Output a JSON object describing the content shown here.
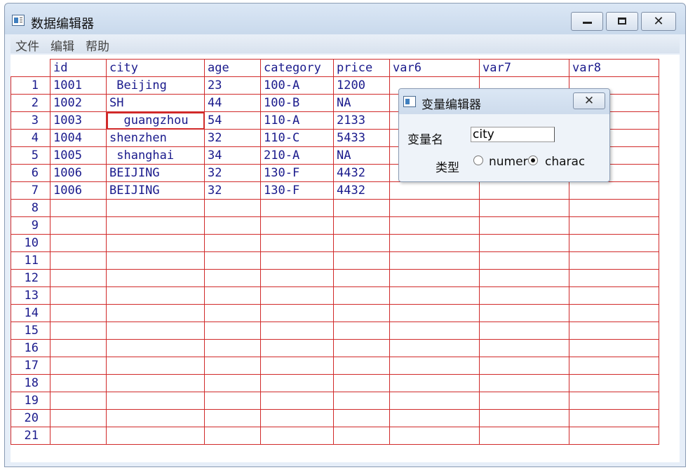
{
  "window": {
    "title": "数据编辑器"
  },
  "menu": [
    "文件",
    "编辑",
    "帮助"
  ],
  "grid": {
    "columns": [
      "id",
      "city",
      "age",
      "category",
      "price",
      "var6",
      "var7",
      "var8"
    ],
    "rows": [
      [
        "1001",
        " Beijing",
        "23",
        "100-A",
        "1200",
        "",
        "",
        ""
      ],
      [
        "1002",
        "SH",
        "44",
        "100-B",
        "NA",
        "",
        "",
        ""
      ],
      [
        "1003",
        "  guangzhou",
        "54",
        "110-A",
        "2133",
        "",
        "",
        ""
      ],
      [
        "1004",
        "shenzhen",
        "32",
        "110-C",
        "5433",
        "",
        "",
        ""
      ],
      [
        "1005",
        " shanghai",
        "34",
        "210-A",
        "NA",
        "",
        "",
        ""
      ],
      [
        "1006",
        "BEIJING",
        "32",
        "130-F",
        "4432",
        "",
        "",
        ""
      ],
      [
        "1006",
        "BEIJING",
        "32",
        "130-F",
        "4432",
        "",
        "",
        ""
      ],
      [
        "",
        "",
        "",
        "",
        "",
        "",
        "",
        ""
      ],
      [
        "",
        "",
        "",
        "",
        "",
        "",
        "",
        ""
      ],
      [
        "",
        "",
        "",
        "",
        "",
        "",
        "",
        ""
      ],
      [
        "",
        "",
        "",
        "",
        "",
        "",
        "",
        ""
      ],
      [
        "",
        "",
        "",
        "",
        "",
        "",
        "",
        ""
      ],
      [
        "",
        "",
        "",
        "",
        "",
        "",
        "",
        ""
      ],
      [
        "",
        "",
        "",
        "",
        "",
        "",
        "",
        ""
      ],
      [
        "",
        "",
        "",
        "",
        "",
        "",
        "",
        ""
      ],
      [
        "",
        "",
        "",
        "",
        "",
        "",
        "",
        ""
      ],
      [
        "",
        "",
        "",
        "",
        "",
        "",
        "",
        ""
      ],
      [
        "",
        "",
        "",
        "",
        "",
        "",
        "",
        ""
      ],
      [
        "",
        "",
        "",
        "",
        "",
        "",
        "",
        ""
      ],
      [
        "",
        "",
        "",
        "",
        "",
        "",
        "",
        ""
      ],
      [
        "",
        "",
        "",
        "",
        "",
        "",
        "",
        ""
      ]
    ],
    "selected_cell": {
      "row": 3,
      "column": "city"
    }
  },
  "dialog": {
    "title": "变量编辑器",
    "name_label": "变量名",
    "name_value": "city",
    "type_label": "类型",
    "type_options": [
      {
        "label": "numeric",
        "selected": false
      },
      {
        "label": "character",
        "selected": true
      }
    ]
  },
  "colors": {
    "grid_border": "#d12a2a",
    "cell_text": "#1a1a8c",
    "titlebar": "#c9d9ec"
  },
  "icons": [
    "window-app-icon",
    "minimize-icon",
    "maximize-icon",
    "close-icon",
    "radio-icon"
  ]
}
